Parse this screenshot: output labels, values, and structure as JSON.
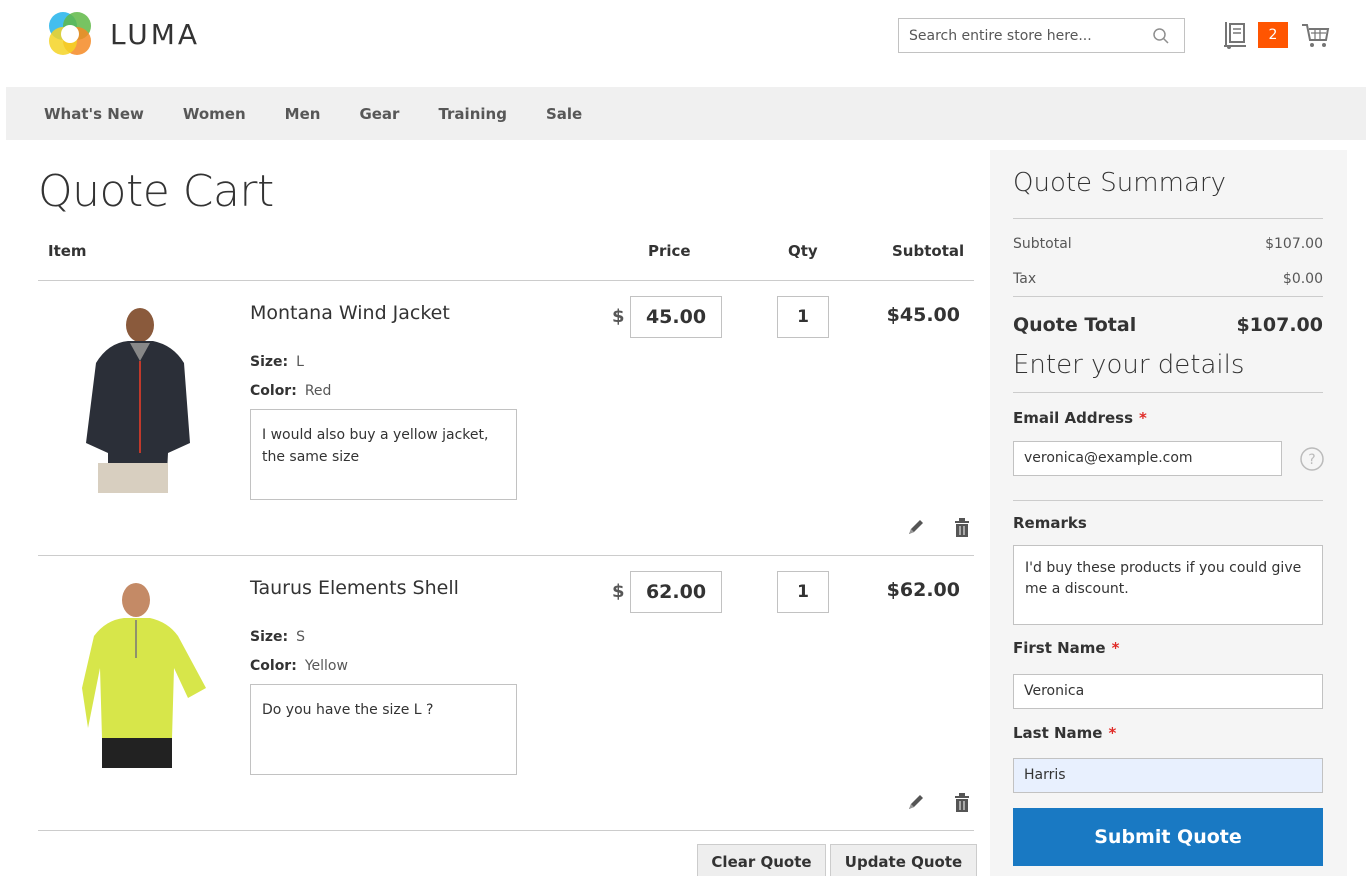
{
  "header": {
    "logo_text": "LUMA",
    "search_placeholder": "Search entire store here...",
    "quote_count": "2"
  },
  "nav": {
    "items": [
      "What's New",
      "Women",
      "Men",
      "Gear",
      "Training",
      "Sale"
    ]
  },
  "page_title": "Quote Cart",
  "table": {
    "headers": {
      "item": "Item",
      "price": "Price",
      "qty": "Qty",
      "subtotal": "Subtotal"
    },
    "currency_symbol": "$",
    "size_label": "Size:",
    "color_label": "Color:",
    "rows": [
      {
        "name": "Montana Wind Jacket",
        "size": "L",
        "color": "Red",
        "remark": "I would also buy a yellow jacket, the same size",
        "price": "45.00",
        "qty": "1",
        "subtotal": "$45.00"
      },
      {
        "name": "Taurus Elements Shell",
        "size": "S",
        "color": "Yellow",
        "remark": "Do you have the size L ?",
        "price": "62.00",
        "qty": "1",
        "subtotal": "$62.00"
      }
    ]
  },
  "buttons": {
    "clear": "Clear Quote",
    "update": "Update Quote"
  },
  "summary": {
    "title": "Quote Summary",
    "subtotal_label": "Subtotal",
    "subtotal_value": "$107.00",
    "tax_label": "Tax",
    "tax_value": "$0.00",
    "total_label": "Quote Total",
    "total_value": "$107.00"
  },
  "details": {
    "title": "Enter your details",
    "email_label": "Email Address",
    "email_value": "veronica@example.com",
    "remarks_label": "Remarks",
    "remarks_value": "I'd buy these products if you could give me a discount.",
    "first_name_label": "First Name",
    "first_name_value": "Veronica",
    "last_name_label": "Last Name",
    "last_name_value": "Harris",
    "required_mark": "*",
    "submit_label": "Submit Quote"
  },
  "colors": {
    "accent": "#1979c3",
    "badge": "#ff5501",
    "required": "#e02b27"
  }
}
